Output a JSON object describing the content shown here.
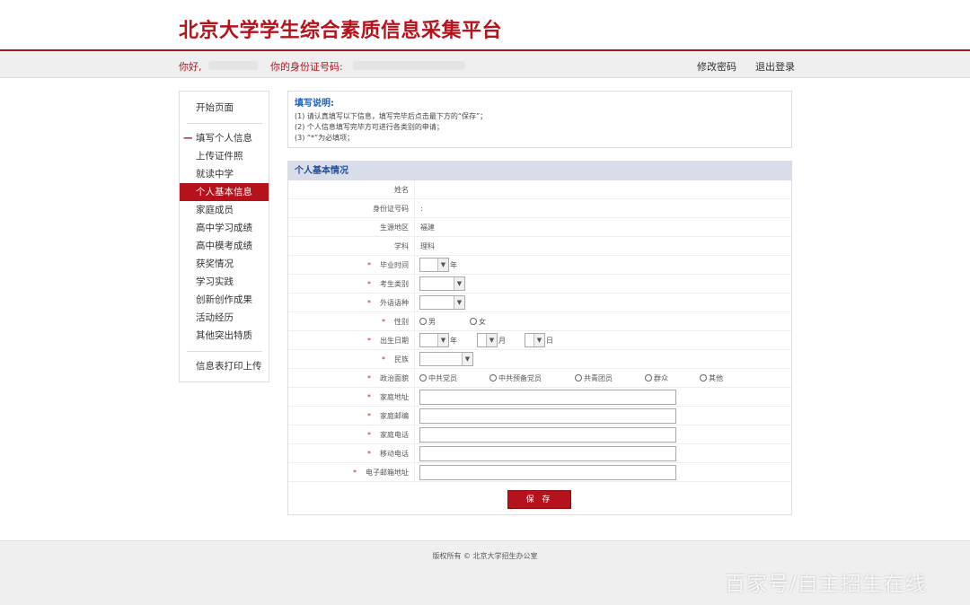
{
  "header": {
    "title": "北京大学学生综合素质信息采集平台"
  },
  "userbar": {
    "greeting": "你好,",
    "id_label": "你的身份证号码:",
    "change_password": "修改密码",
    "logout": "退出登录"
  },
  "sidebar": {
    "start": "开始页面",
    "group_title": "填写个人信息",
    "items": [
      "上传证件照",
      "就读中学",
      "个人基本信息",
      "家庭成员",
      "高中学习成绩",
      "高中模考成绩",
      "获奖情况",
      "学习实践",
      "创新创作成果",
      "活动经历",
      "其他突出特质"
    ],
    "active_item": "个人基本信息",
    "print_upload": "信息表打印上传"
  },
  "instructions": {
    "title": "填写说明:",
    "lines": [
      "(1) 请认真填写以下信息，填写完毕后点击最下方的“保存”；",
      "(2) 个人信息填写完毕方可进行各类别的申请；",
      "(3) “*”为必填项；"
    ]
  },
  "form": {
    "section_title": "个人基本情况",
    "required_mark": "*",
    "fields": {
      "name": {
        "label": "姓名",
        "value": ""
      },
      "id_number": {
        "label": "身份证号码",
        "value": ":"
      },
      "origin": {
        "label": "生源地区",
        "value": "福建"
      },
      "subject": {
        "label": "学科",
        "value": "理科"
      },
      "graduation": {
        "label": "毕业时间",
        "unit": "年"
      },
      "candidate_type": {
        "label": "考生类别"
      },
      "language": {
        "label": "外语语种"
      },
      "gender": {
        "label": "性别",
        "options": [
          "男",
          "女"
        ]
      },
      "birth_date": {
        "label": "出生日期",
        "year": "年",
        "month": "月",
        "day": "日"
      },
      "ethnicity": {
        "label": "民族"
      },
      "political": {
        "label": "政治面貌",
        "options": [
          "中共党员",
          "中共预备党员",
          "共青团员",
          "群众",
          "其他"
        ]
      },
      "address": {
        "label": "家庭地址",
        "value": ""
      },
      "postcode": {
        "label": "家庭邮编",
        "value": ""
      },
      "home_phone": {
        "label": "家庭电话",
        "value": ""
      },
      "mobile": {
        "label": "移动电话",
        "value": ""
      },
      "email": {
        "label": "电子邮箱地址",
        "value": ""
      }
    },
    "save_label": "保 存"
  },
  "footer": {
    "copyright": "版权所有 © 北京大学招生办公室"
  },
  "watermark": "百家号/自主招生在线",
  "colors": {
    "brand": "#b5121b",
    "section_header": "#d9dde9",
    "link_blue": "#1f5fbf"
  },
  "icons": [
    "chevron-down-icon",
    "radio-icon"
  ]
}
